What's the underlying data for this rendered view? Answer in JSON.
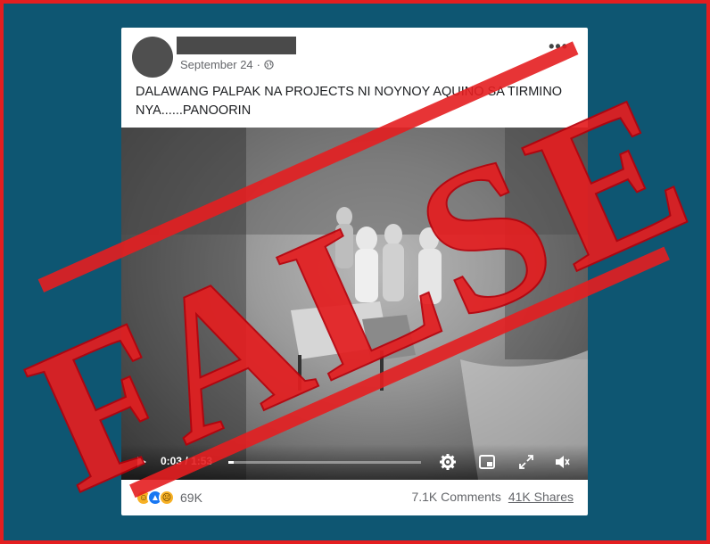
{
  "post": {
    "date": "September 24",
    "date_separator": "·",
    "caption": "DALAWANG PALPAK NA PROJECTS NI NOYNOY AQUINO SA TIRMINO NYA......PANOORIN",
    "more_label": "•••"
  },
  "video": {
    "time": "0:03 / 1:53",
    "progress": 0.03,
    "icons": [
      "play-icon",
      "gear-icon",
      "mini-player-icon",
      "fullscreen-icon",
      "volume-icon"
    ]
  },
  "footer": {
    "reaction_count": "69K",
    "comments": "7.1K Comments",
    "shares": "41K Shares",
    "reaction_icons": [
      "haha-icon",
      "like-icon",
      "sad-icon"
    ]
  },
  "stamp": {
    "text": "FALSE",
    "color": "#e41e20"
  },
  "colors": {
    "background": "#0e5672",
    "border": "#e41e20"
  }
}
